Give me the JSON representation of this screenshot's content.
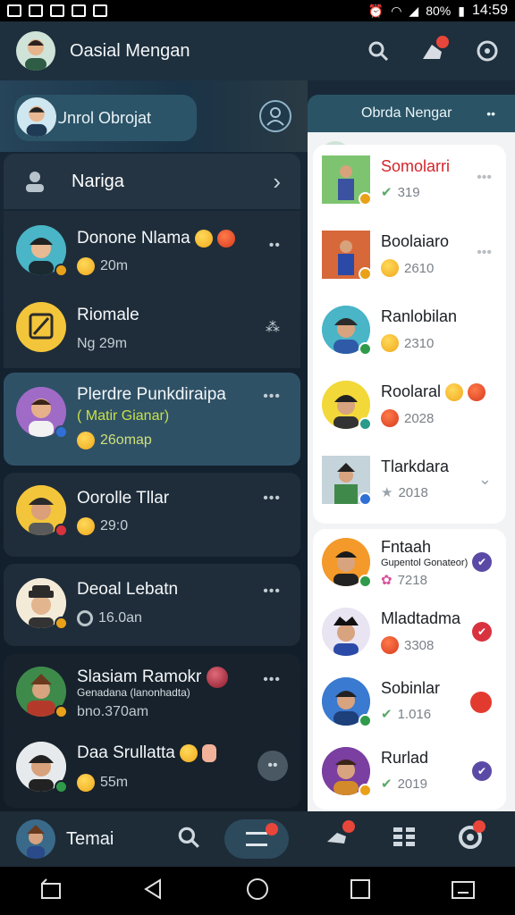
{
  "status": {
    "battery": "80%",
    "time": "14:59"
  },
  "appbar": {
    "title": "Oasial Mengan"
  },
  "left_header": {
    "chip_label": "Unrol Obrojat"
  },
  "left_nav": {
    "label": "Nariga"
  },
  "left_items": [
    {
      "name": "Donone Nlama",
      "sub": "20m"
    },
    {
      "name": "Riomale",
      "sub": "Ng 29m"
    },
    {
      "name": "Plerdre Punkdiraipa",
      "tag": "( Matir Gianar)",
      "sub": "26omap"
    },
    {
      "name": "Oorolle Tllar",
      "sub": "29:0"
    },
    {
      "name": "Deoal Lebatn",
      "sub": "16.0an"
    },
    {
      "name": "Slasiam Ramokr",
      "tag": "Genadana (lanonhadta)",
      "sub": "bno.370am"
    },
    {
      "name": "Daa Srullatta",
      "sub": "55m"
    }
  ],
  "right_header": {
    "title": "Obrda Nengar"
  },
  "right_items_top": [
    {
      "name": "Somolarri",
      "sub": "319",
      "highlight": "#d4252b"
    },
    {
      "name": "Boolaiaro",
      "sub": "2610"
    },
    {
      "name": "Ranlobilan",
      "sub": "2310"
    },
    {
      "name": "Roolaral",
      "sub": "2028"
    },
    {
      "name": "Tlarkdara",
      "sub": "2018"
    }
  ],
  "right_items_bottom": [
    {
      "name": "Fntaah",
      "tag": "Gupentol Gonateor)",
      "sub": "7218",
      "status_color": "#5b4aa5"
    },
    {
      "name": "Mladtadma",
      "sub": "3308",
      "status_color": "#d9323f"
    },
    {
      "name": "Sobinlar",
      "sub": "1.016",
      "status_color": "#e33a30"
    },
    {
      "name": "Rurlad",
      "sub": "2019",
      "status_color": "#5b4aa5"
    }
  ],
  "bottom_nav": {
    "label": "Temai"
  }
}
